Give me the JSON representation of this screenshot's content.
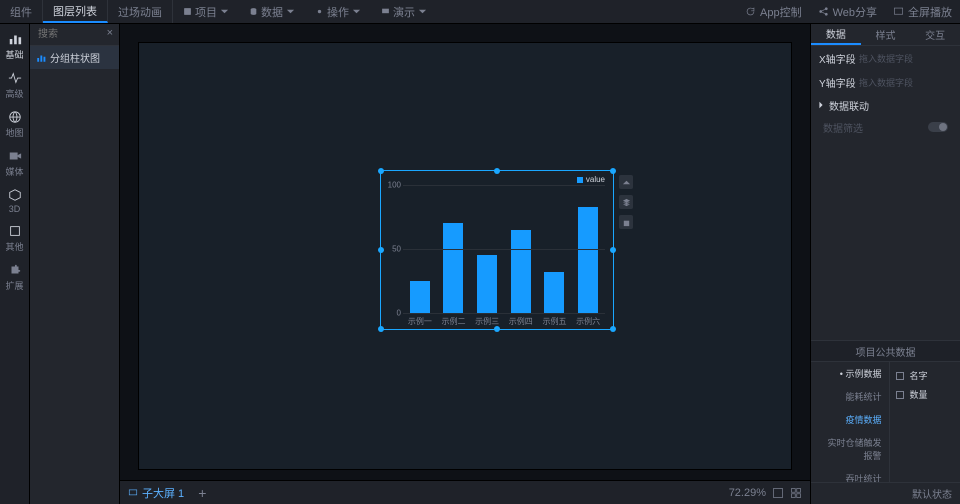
{
  "topbar": {
    "tabs_left": [
      "组件",
      "图层列表",
      "过场动画"
    ],
    "active_left_tab": 1,
    "menus": [
      {
        "icon": "page",
        "label": "项目"
      },
      {
        "icon": "db",
        "label": "数据"
      },
      {
        "icon": "gear",
        "label": "操作"
      },
      {
        "icon": "play",
        "label": "演示"
      }
    ],
    "right_actions": [
      {
        "icon": "refresh",
        "label": "App控制"
      },
      {
        "icon": "share",
        "label": "Web分享"
      },
      {
        "icon": "fullscreen",
        "label": "全屏播放"
      }
    ]
  },
  "rail": [
    {
      "icon": "bar",
      "label": "基础",
      "active": true
    },
    {
      "icon": "pulse",
      "label": "高级"
    },
    {
      "icon": "globe",
      "label": "地图"
    },
    {
      "icon": "video",
      "label": "媒体"
    },
    {
      "icon": "cube",
      "label": "3D"
    },
    {
      "icon": "misc",
      "label": "其他"
    },
    {
      "icon": "ext",
      "label": "扩展"
    }
  ],
  "layers": {
    "search_placeholder": "搜索",
    "items": [
      {
        "label": "分组柱状图"
      }
    ]
  },
  "chart_data": {
    "type": "bar",
    "legend": "value",
    "yticks": [
      0,
      50,
      100
    ],
    "ylim": [
      0,
      100
    ],
    "categories": [
      "示例一",
      "示例二",
      "示例三",
      "示例四",
      "示例五",
      "示例六"
    ],
    "values": [
      25,
      70,
      45,
      65,
      32,
      83
    ]
  },
  "bottom": {
    "subscreen_label": "子大屏 1",
    "zoom": "72.29%"
  },
  "right": {
    "tabs": [
      "数据",
      "样式",
      "交互"
    ],
    "active_tab": 0,
    "x_field_label": "X轴字段",
    "y_field_label": "Y轴字段",
    "field_placeholder": "拖入数据字段",
    "linkage_label": "数据联动",
    "filter_label": "数据筛选",
    "project_data_header": "项目公共数据",
    "datasources": [
      "示例数据",
      "能耗统计",
      "疫情数据",
      "实时仓储触发报警",
      "吞吐统计"
    ],
    "datasource_sel_star": 0,
    "datasource_active": 2,
    "fields": [
      "名字",
      "数量"
    ],
    "footer": "默认状态"
  }
}
